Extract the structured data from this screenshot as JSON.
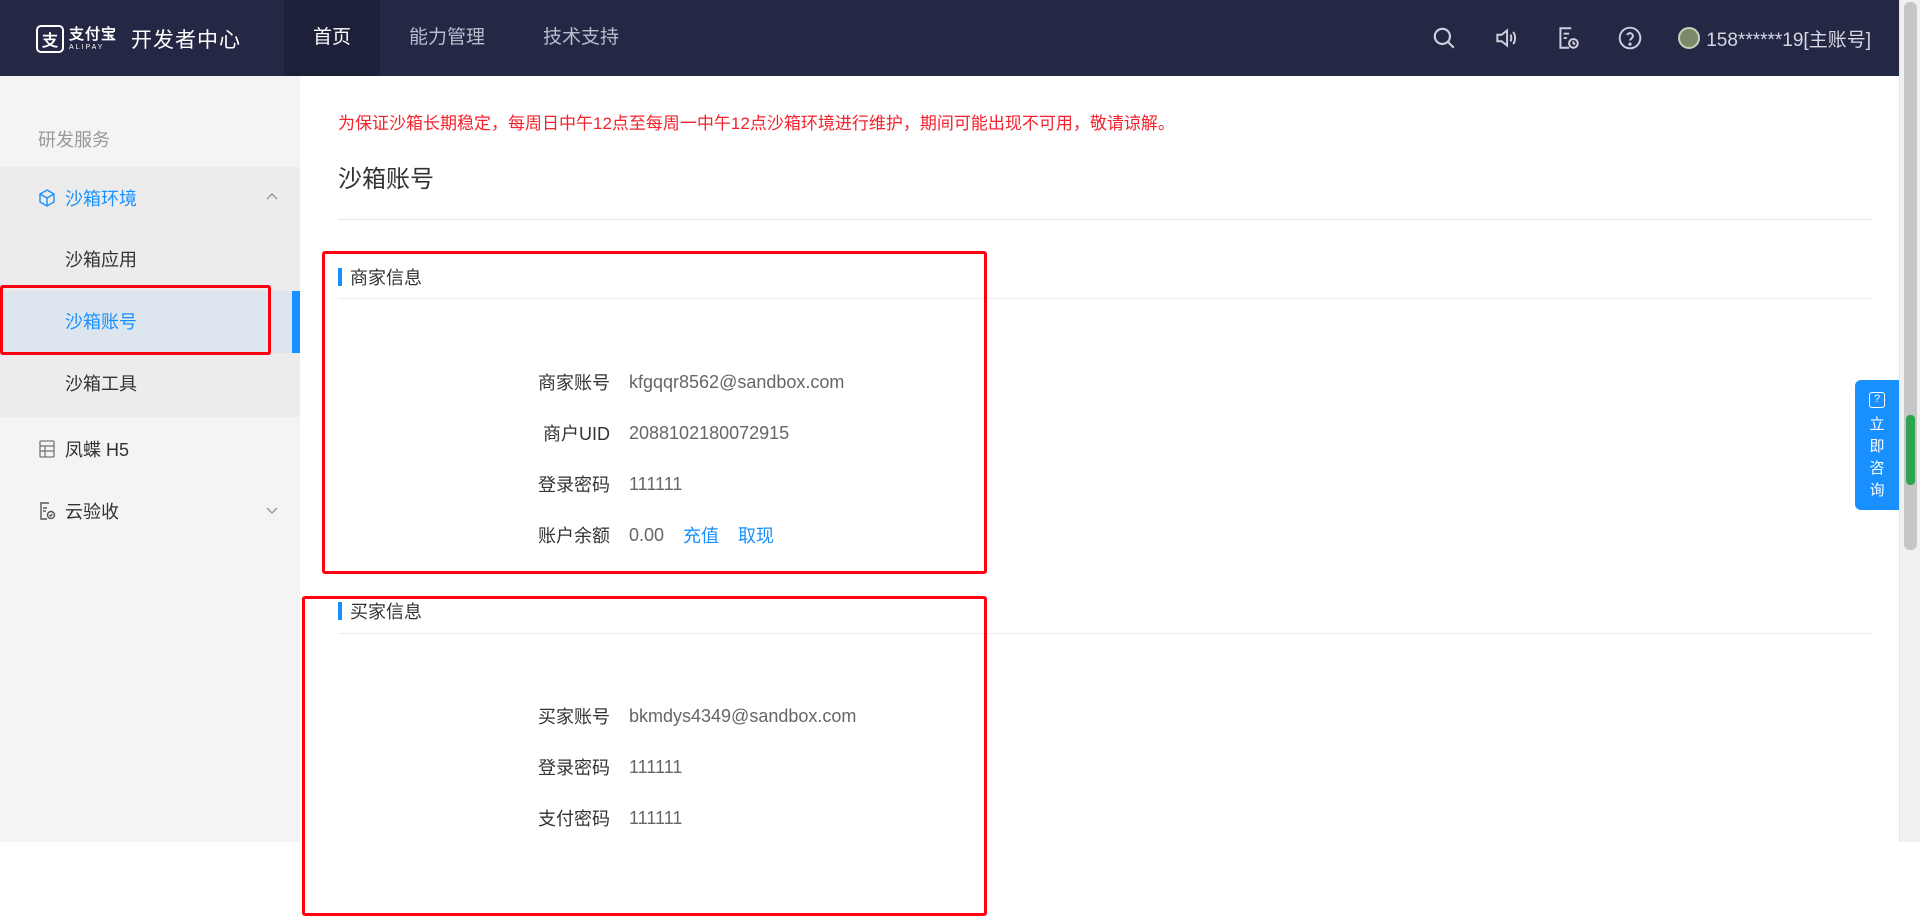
{
  "header": {
    "logo_cn": "支付宝",
    "logo_en": "ALIPAY",
    "title": "开发者中心",
    "nav": [
      {
        "label": "首页"
      },
      {
        "label": "能力管理"
      },
      {
        "label": "技术支持"
      }
    ],
    "user_label": "158******19[主账号]"
  },
  "sidebar": {
    "section_label": "研发服务",
    "groups": [
      {
        "label": "沙箱环境",
        "icon": "cube-icon",
        "expanded": true
      },
      {
        "label": "凤蝶 H5",
        "icon": "h5-icon"
      },
      {
        "label": "云验收",
        "icon": "checklist-icon",
        "expanded": false
      }
    ],
    "sub_items": [
      {
        "label": "沙箱应用"
      },
      {
        "label": "沙箱账号",
        "active": true
      },
      {
        "label": "沙箱工具"
      }
    ]
  },
  "main": {
    "notice": "为保证沙箱长期稳定，每周日中午12点至每周一中午12点沙箱环境进行维护，期间可能出现不可用，敬请谅解。",
    "page_title": "沙箱账号",
    "merchant": {
      "heading": "商家信息",
      "rows": [
        {
          "label": "商家账号",
          "value": "kfgqqr8562@sandbox.com"
        },
        {
          "label": "商户UID",
          "value": "2088102180072915"
        },
        {
          "label": "登录密码",
          "value": "111111"
        },
        {
          "label": "账户余额",
          "value": "0.00"
        }
      ],
      "recharge_label": "充值",
      "withdraw_label": "取现"
    },
    "buyer": {
      "heading": "买家信息",
      "rows": [
        {
          "label": "买家账号",
          "value": "bkmdys4349@sandbox.com"
        },
        {
          "label": "登录密码",
          "value": "111111"
        },
        {
          "label": "支付密码",
          "value": "111111"
        }
      ]
    }
  },
  "consult": {
    "chars": [
      "立",
      "即",
      "咨",
      "询"
    ]
  },
  "colors": {
    "topbar": "#242845",
    "accent": "#1890ff",
    "notice": "#f5222d",
    "highlight_box": "#ff0010"
  }
}
